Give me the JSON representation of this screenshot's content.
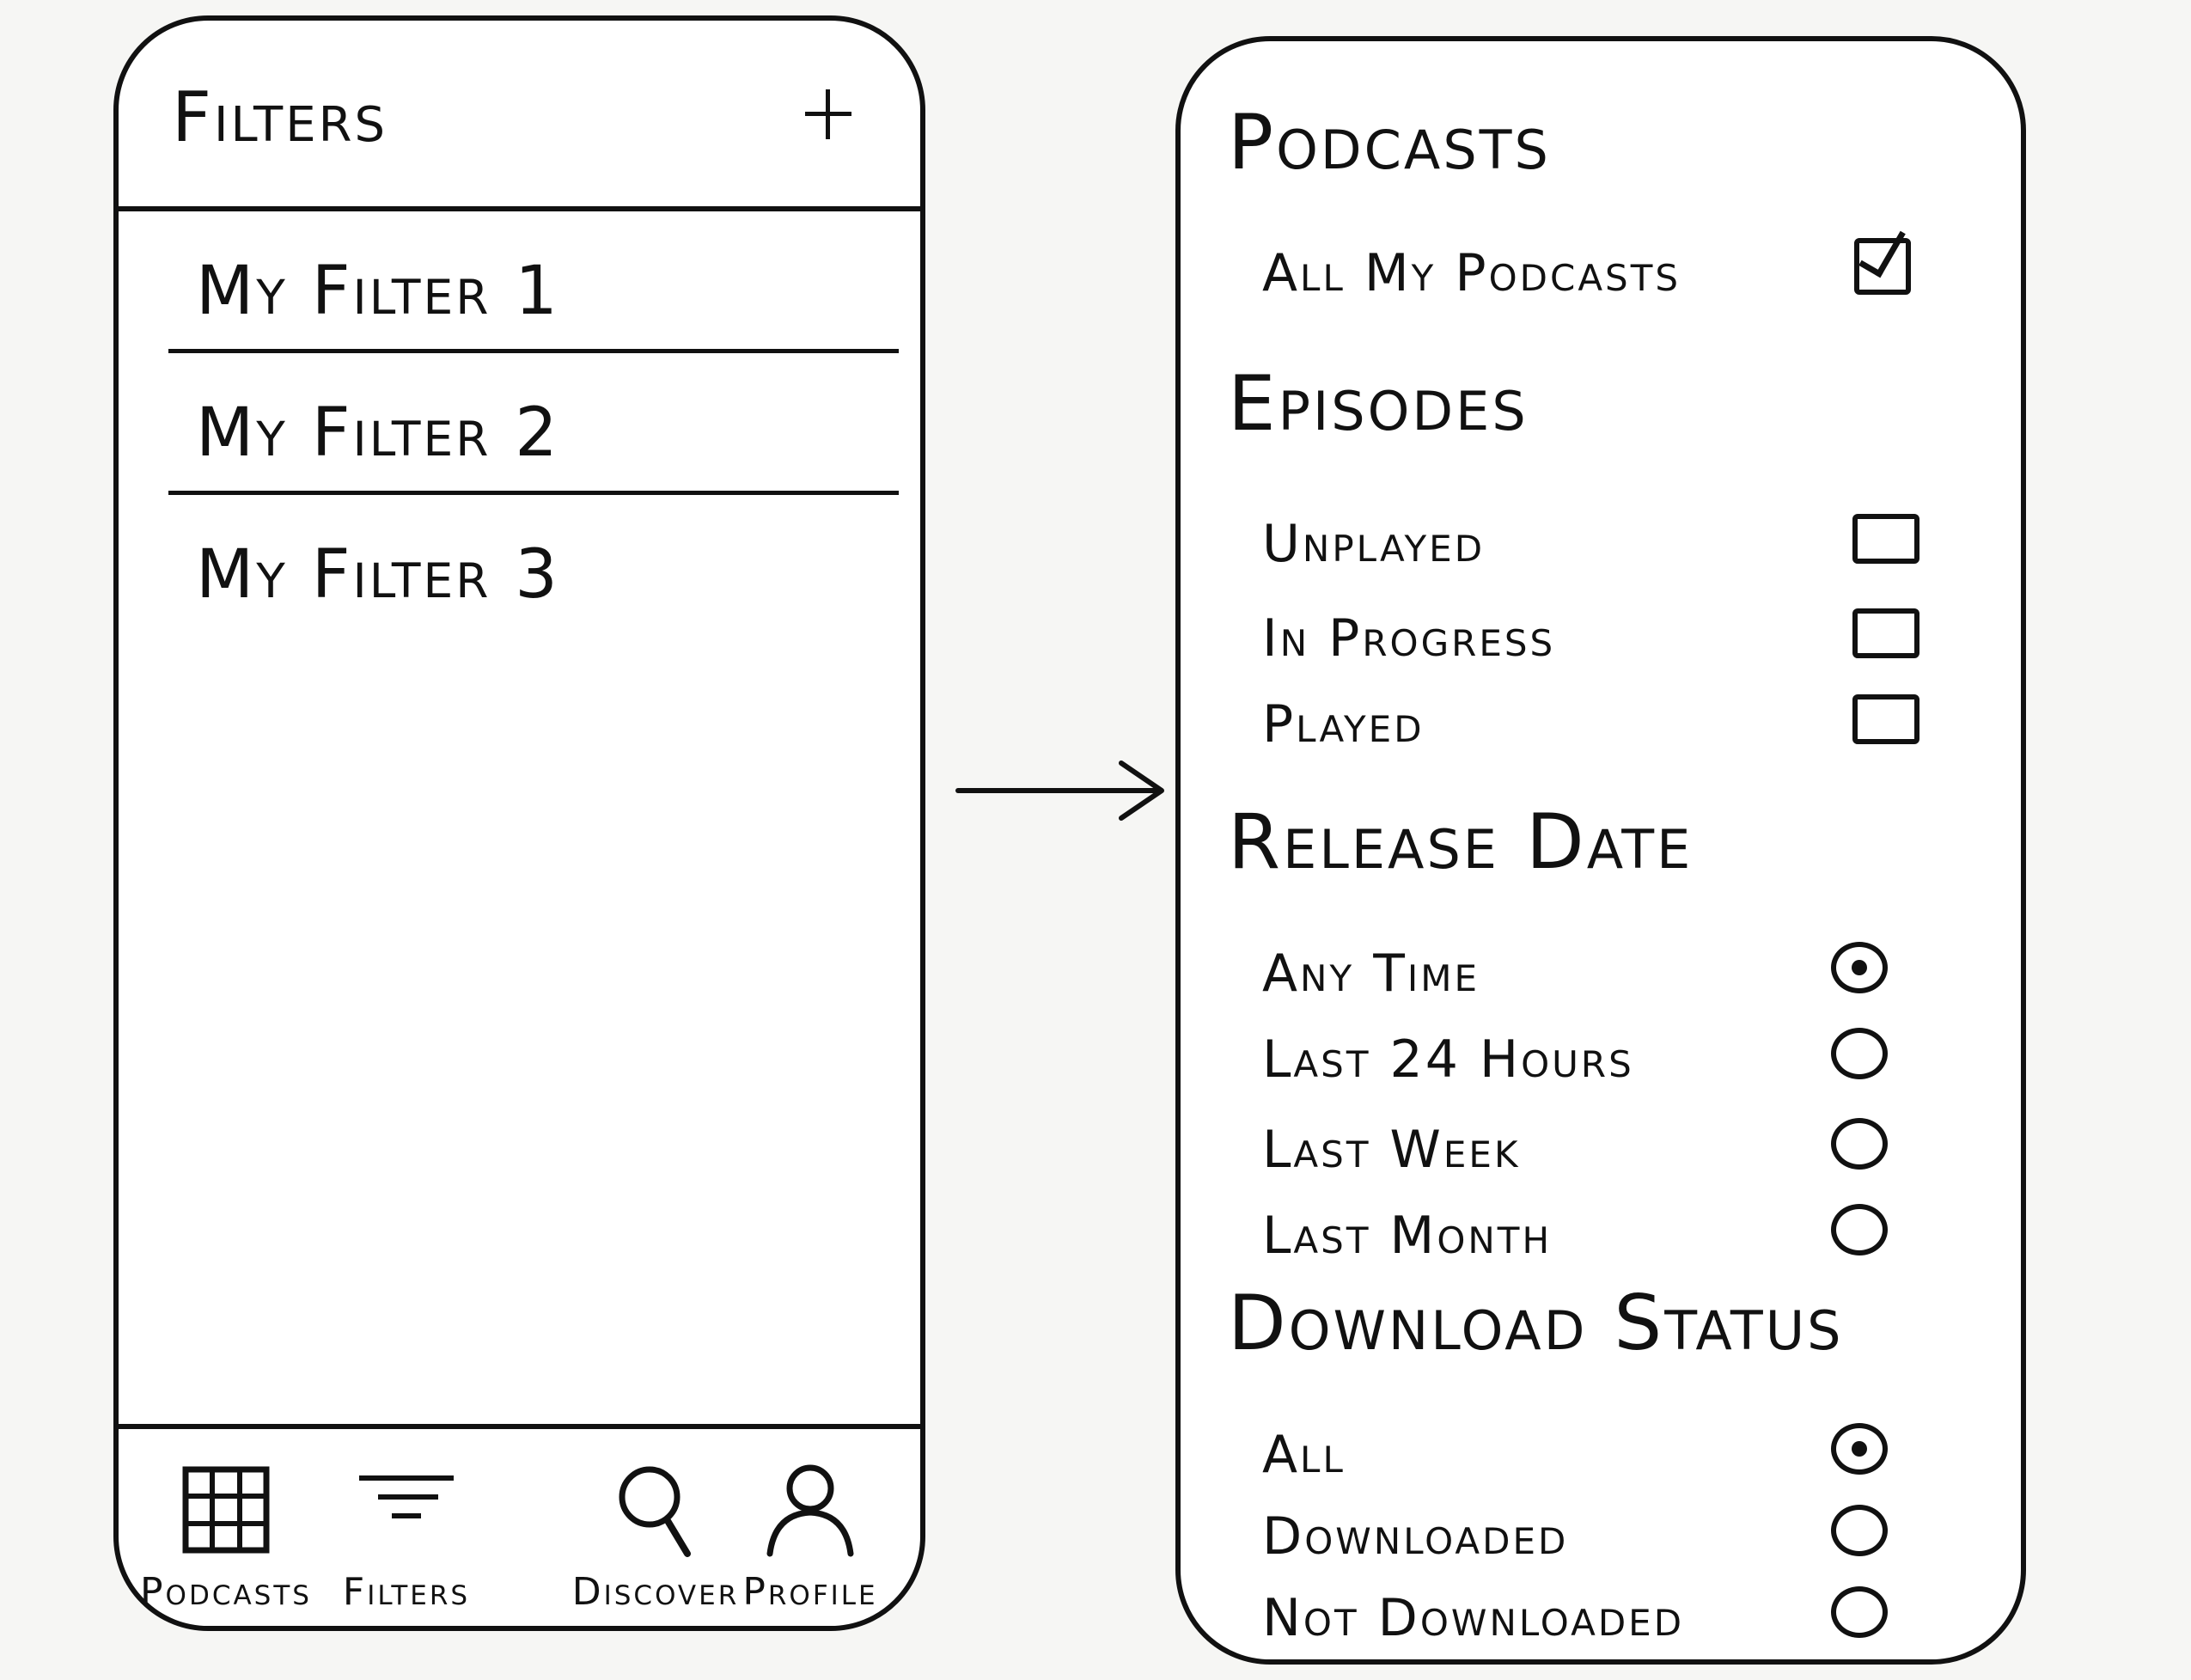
{
  "filters_screen": {
    "title": "Filters",
    "add_icon": "plus-icon",
    "filters": [
      "My Filter 1",
      "My Filter 2",
      "My Filter 3"
    ],
    "tabs": [
      {
        "label": "Podcasts",
        "icon": "grid-icon"
      },
      {
        "label": "Filters",
        "icon": "filter-lines-icon"
      },
      {
        "label": "Discover",
        "icon": "search-icon"
      },
      {
        "label": "Profile",
        "icon": "person-icon"
      }
    ]
  },
  "flow_arrow_icon": "arrow-right-icon",
  "filter_options_screen": {
    "podcasts": {
      "title": "Podcasts",
      "options": [
        {
          "label": "All My Podcasts",
          "checked": true
        }
      ]
    },
    "episodes": {
      "title": "Episodes",
      "options": [
        {
          "label": "Unplayed",
          "checked": false
        },
        {
          "label": "In Progress",
          "checked": false
        },
        {
          "label": "Played",
          "checked": false
        }
      ]
    },
    "release_date": {
      "title": "Release Date",
      "options": [
        {
          "label": "Any Time",
          "selected": true
        },
        {
          "label": "Last 24 Hours",
          "selected": false
        },
        {
          "label": "Last Week",
          "selected": false
        },
        {
          "label": "Last Month",
          "selected": false
        }
      ]
    },
    "download_status": {
      "title": "Download Status",
      "options": [
        {
          "label": "All",
          "selected": true
        },
        {
          "label": "Downloaded",
          "selected": false
        },
        {
          "label": "Not Downloaded",
          "selected": false
        }
      ]
    }
  }
}
